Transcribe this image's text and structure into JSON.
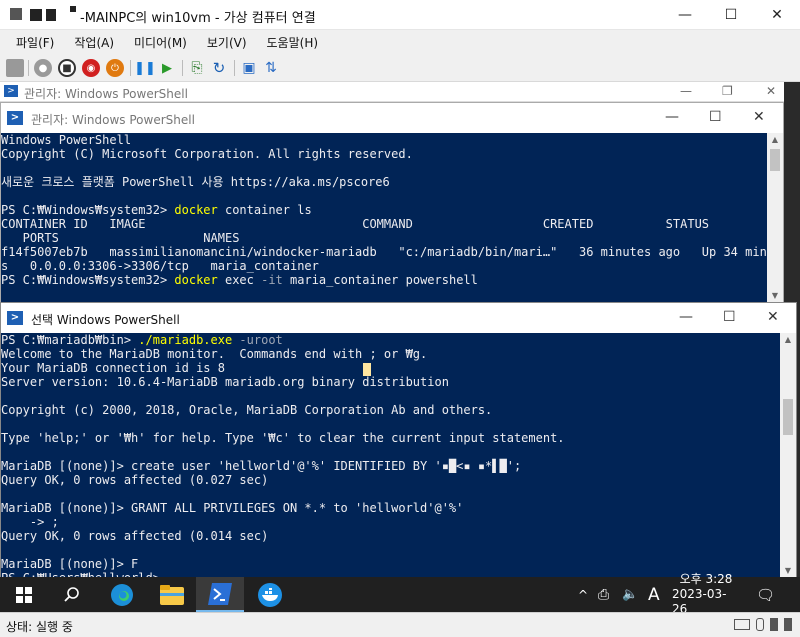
{
  "vm": {
    "title": "-MAINPC의 win10vm - 가상 컴퓨터 연결",
    "menu": [
      "파일(F)",
      "작업(A)",
      "미디어(M)",
      "보기(V)",
      "도움말(H)"
    ],
    "status": "상태: 실행 중"
  },
  "ps_back": {
    "title": "관리자: Windows PowerShell",
    "lines": [
      {
        "parts": [
          {
            "t": "Windows PowerShell"
          }
        ]
      },
      {
        "parts": [
          {
            "t": "Copyright (C) Microsoft Corporation. All rights reserved."
          }
        ]
      },
      {
        "parts": [
          {
            "t": ""
          }
        ]
      },
      {
        "parts": [
          {
            "t": "새로운 크로스 플랫폼 PowerShell 사용 https://aka.ms/pscore6"
          }
        ]
      },
      {
        "parts": [
          {
            "t": ""
          }
        ]
      },
      {
        "parts": [
          {
            "t": "PS C:₩Windows₩system32> "
          },
          {
            "t": "docker",
            "c": "yellow"
          },
          {
            "t": " container ls"
          }
        ]
      },
      {
        "parts": [
          {
            "t": "CONTAINER ID   IMAGE                              COMMAND                  CREATED          STATUS"
          }
        ]
      },
      {
        "parts": [
          {
            "t": "   PORTS                    NAMES"
          }
        ]
      },
      {
        "parts": [
          {
            "t": "f14f5007eb7b   massimilianomancini/windocker-mariadb   \"c:/mariadb/bin/mari…\"   36 minutes ago   Up 34 minute"
          }
        ]
      },
      {
        "parts": [
          {
            "t": "s   0.0.0.0:3306->3306/tcp   maria_container"
          }
        ]
      },
      {
        "parts": [
          {
            "t": "PS C:₩Windows₩system32> "
          },
          {
            "t": "docker",
            "c": "yellow"
          },
          {
            "t": " exec "
          },
          {
            "t": "-it",
            "c": "gray"
          },
          {
            "t": " maria_container powershell"
          }
        ]
      }
    ]
  },
  "ps_front": {
    "title": "선택 Windows PowerShell",
    "lines": [
      {
        "parts": [
          {
            "t": "PS C:₩mariadb₩bin> "
          },
          {
            "t": "./mariadb.exe",
            "c": "yellow"
          },
          {
            "t": " -uroot",
            "c": "gray"
          }
        ]
      },
      {
        "parts": [
          {
            "t": "Welcome to the MariaDB monitor.  Commands end with ; or ₩g."
          }
        ]
      },
      {
        "parts": [
          {
            "t": "Your MariaDB connection id is 8"
          }
        ]
      },
      {
        "parts": [
          {
            "t": "Server version: 10.6.4-MariaDB mariadb.org binary distribution"
          }
        ]
      },
      {
        "parts": [
          {
            "t": ""
          }
        ]
      },
      {
        "parts": [
          {
            "t": "Copyright (c) 2000, 2018, Oracle, MariaDB Corporation Ab and others."
          }
        ]
      },
      {
        "parts": [
          {
            "t": ""
          }
        ]
      },
      {
        "parts": [
          {
            "t": "Type 'help;' or '₩h' for help. Type '₩c' to clear the current input statement."
          }
        ]
      },
      {
        "parts": [
          {
            "t": ""
          }
        ]
      },
      {
        "parts": [
          {
            "t": "MariaDB [(none)]> create user 'hellworld'@'%' IDENTIFIED BY '▪█<▪ ▪*▌█';"
          }
        ]
      },
      {
        "parts": [
          {
            "t": "Query OK, 0 rows affected (0.027 sec)"
          }
        ]
      },
      {
        "parts": [
          {
            "t": ""
          }
        ]
      },
      {
        "parts": [
          {
            "t": "MariaDB [(none)]> GRANT ALL PRIVILEGES ON *.* to 'hellworld'@'%'"
          }
        ]
      },
      {
        "parts": [
          {
            "t": "    -> ;"
          }
        ]
      },
      {
        "parts": [
          {
            "t": "Query OK, 0 rows affected (0.014 sec)"
          }
        ]
      },
      {
        "parts": [
          {
            "t": ""
          }
        ]
      },
      {
        "parts": [
          {
            "t": "MariaDB [(none)]> F"
          }
        ]
      },
      {
        "parts": [
          {
            "t": "PS C:₩Users₩hellworld> _"
          }
        ]
      }
    ]
  },
  "taskbar": {
    "ime": "A",
    "time": "오후 3:28",
    "date": "2023-03-26"
  },
  "colors": {
    "console_bg": "#012456",
    "console_fg": "#eeedf0",
    "command_yellow": "#ffff00",
    "taskbar_bg": "#202020"
  }
}
